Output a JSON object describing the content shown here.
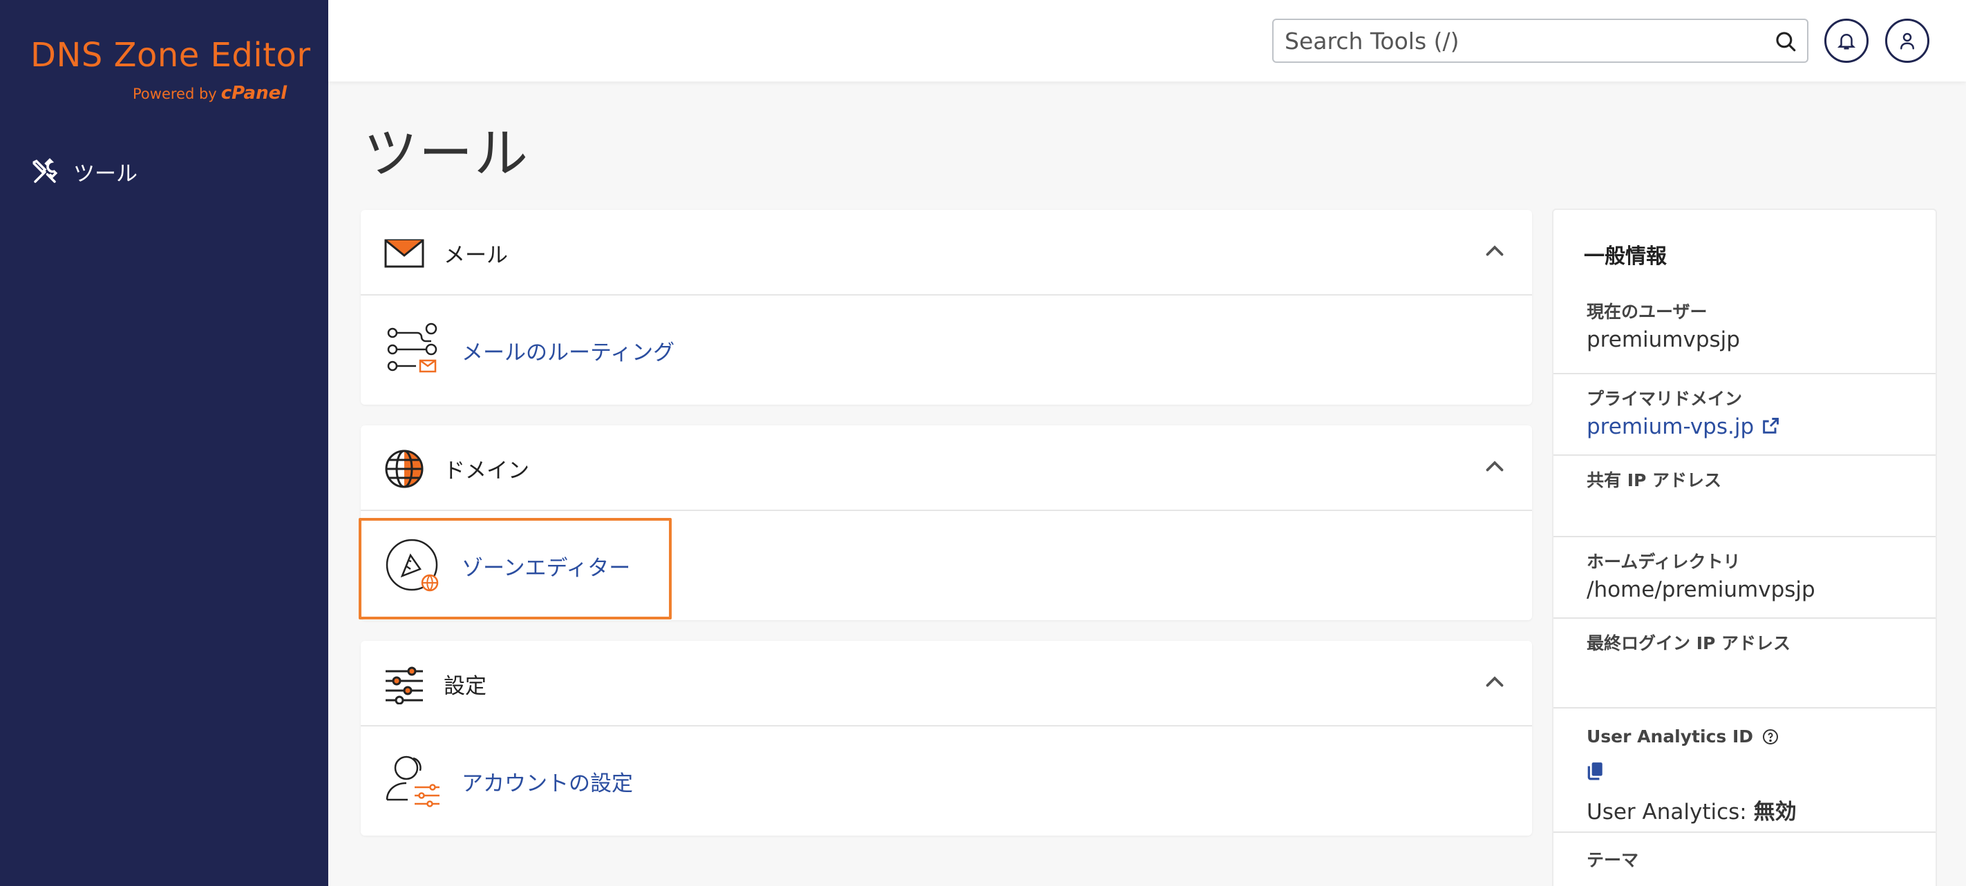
{
  "sidebar": {
    "brand_title": "DNS Zone Editor",
    "powered_by": "Powered by",
    "powered_brand": "cPanel",
    "items": [
      {
        "label": "ツール",
        "icon": "tools-icon"
      }
    ]
  },
  "header": {
    "search_placeholder": "Search Tools (/)",
    "icons": [
      "search-icon",
      "bell-icon",
      "user-icon"
    ]
  },
  "page_title": "ツール",
  "panels": [
    {
      "title": "メール",
      "icon": "envelope-icon",
      "tools": [
        {
          "label": "メールのルーティング",
          "icon": "email-routing-icon"
        }
      ]
    },
    {
      "title": "ドメイン",
      "icon": "globe-icon",
      "tools": [
        {
          "label": "ゾーンエディター",
          "icon": "zone-editor-icon"
        }
      ]
    },
    {
      "title": "設定",
      "icon": "sliders-icon",
      "tools": [
        {
          "label": "アカウントの設定",
          "icon": "account-settings-icon"
        }
      ]
    }
  ],
  "info": {
    "title": "一般情報",
    "current_user_label": "現在のユーザー",
    "current_user": "premiumvpsjp",
    "primary_domain_label": "プライマリドメイン",
    "primary_domain": "premium-vps.jp",
    "shared_ip_label": "共有 IP アドレス",
    "home_dir_label": "ホームディレクトリ",
    "home_dir": "/home/premiumvpsjp",
    "last_login_label": "最終ログイン IP アドレス",
    "analytics_id_label": "User Analytics ID",
    "analytics_status_label": "User Analytics:",
    "analytics_status": "無効",
    "theme_label": "テーマ"
  },
  "colors": {
    "sidebar": "#1f2551",
    "accent": "#f06e22",
    "link": "#2b4ea0",
    "highlight": "#f0802e"
  }
}
